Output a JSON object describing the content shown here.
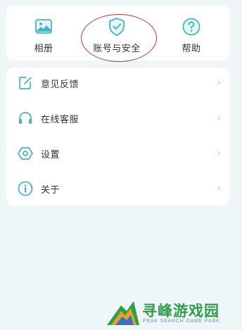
{
  "quick_actions": [
    {
      "label": "相册",
      "icon": "photo-album-icon"
    },
    {
      "label": "账号与安全",
      "icon": "shield-check-icon"
    },
    {
      "label": "帮助",
      "icon": "help-circle-icon"
    }
  ],
  "menu": [
    {
      "label": "意见反馈",
      "icon": "edit-feedback-icon"
    },
    {
      "label": "在线客服",
      "icon": "headphones-icon"
    },
    {
      "label": "设置",
      "icon": "settings-icon"
    },
    {
      "label": "关于",
      "icon": "info-icon"
    }
  ],
  "chevron": "›",
  "watermark": {
    "title": "寻峰游戏园",
    "subtitle": "PEAK SEARCH GAME PARK"
  },
  "colors": {
    "accent_icon": "#4ab3c8",
    "background": "#eef6f7",
    "highlight_ring": "#b03a3a",
    "watermark_green": "#2f9e4b"
  }
}
